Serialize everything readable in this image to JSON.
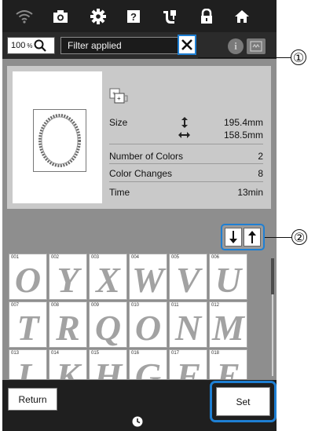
{
  "toolbar": {
    "zoom_value": "100",
    "zoom_unit": "%",
    "filter_text": "Filter applied"
  },
  "details": {
    "size_label": "Size",
    "size_height": "195.4mm",
    "size_width": "158.5mm",
    "colors_label": "Number of Colors",
    "colors_value": "2",
    "changes_label": "Color Changes",
    "changes_value": "8",
    "time_label": "Time",
    "time_value": "13min"
  },
  "patterns": [
    {
      "num": "001",
      "glyph": "O"
    },
    {
      "num": "002",
      "glyph": "Y"
    },
    {
      "num": "003",
      "glyph": "X"
    },
    {
      "num": "004",
      "glyph": "W"
    },
    {
      "num": "005",
      "glyph": "V"
    },
    {
      "num": "006",
      "glyph": "U"
    },
    {
      "num": "007",
      "glyph": "T"
    },
    {
      "num": "008",
      "glyph": "R"
    },
    {
      "num": "009",
      "glyph": "Q"
    },
    {
      "num": "010",
      "glyph": "O"
    },
    {
      "num": "011",
      "glyph": "N"
    },
    {
      "num": "012",
      "glyph": "M"
    },
    {
      "num": "013",
      "glyph": "L"
    },
    {
      "num": "014",
      "glyph": "K"
    },
    {
      "num": "015",
      "glyph": "H"
    },
    {
      "num": "016",
      "glyph": "G"
    },
    {
      "num": "017",
      "glyph": "F"
    },
    {
      "num": "018",
      "glyph": "E"
    }
  ],
  "buttons": {
    "return_label": "Return",
    "set_label": "Set"
  },
  "callouts": {
    "c1": "①",
    "c2": "②"
  },
  "icons": {
    "top": [
      "wifi-icon",
      "camera-icon",
      "settings-icon",
      "help-icon",
      "embroidery-icon",
      "lock-icon",
      "home-icon"
    ],
    "accent": "#1e7fd3"
  }
}
